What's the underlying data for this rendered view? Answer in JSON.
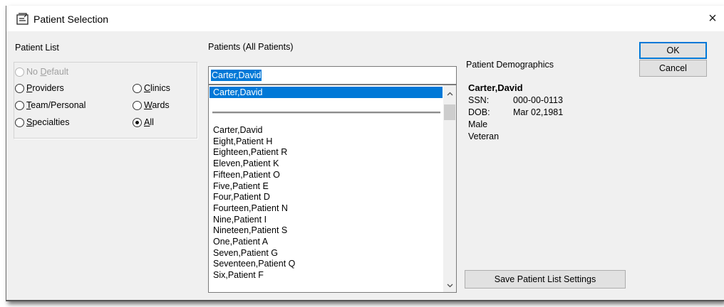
{
  "window": {
    "title": "Patient Selection",
    "close_glyph": "×",
    "icon": "patient-selection-icon"
  },
  "patient_list": {
    "label": "Patient List",
    "options": [
      {
        "label": "No Default",
        "accel": "D",
        "checked": false,
        "disabled": true
      },
      {
        "label": "Providers",
        "accel": "P",
        "checked": false,
        "disabled": false
      },
      {
        "label": "Team/Personal",
        "accel": "T",
        "checked": false,
        "disabled": false
      },
      {
        "label": "Specialties",
        "accel": "S",
        "checked": false,
        "disabled": false
      },
      {
        "label": "Clinics",
        "accel": "C",
        "checked": false,
        "disabled": false
      },
      {
        "label": "Wards",
        "accel": "W",
        "checked": false,
        "disabled": false
      },
      {
        "label": "All",
        "accel": "A",
        "checked": true,
        "disabled": false
      }
    ]
  },
  "patients": {
    "label": "Patients (All Patients)",
    "search_value": "Carter,David",
    "selected_item": "Carter,David",
    "items": [
      "Carter,David",
      "Eight,Patient H",
      "Eighteen,Patient R",
      "Eleven,Patient K",
      "Fifteen,Patient O",
      "Five,Patient E",
      "Four,Patient D",
      "Fourteen,Patient N",
      "Nine,Patient I",
      "Nineteen,Patient S",
      "One,Patient A",
      "Seven,Patient G",
      "Seventeen,Patient Q",
      "Six,Patient F"
    ],
    "scroll_up_glyph": "^",
    "scroll_down_glyph": "v"
  },
  "demographics": {
    "label": "Patient Demographics",
    "name": "Carter,David",
    "ssn_label": "SSN:",
    "ssn": "000-00-0113",
    "dob_label": "DOB:",
    "dob": "Mar 02,1981",
    "sex": "Male",
    "status": "Veteran"
  },
  "buttons": {
    "ok": "OK",
    "cancel": "Cancel",
    "save_settings": "Save Patient List Settings"
  },
  "colors": {
    "selection": "#0078d7",
    "dialog_bg": "#f0f0f0"
  }
}
